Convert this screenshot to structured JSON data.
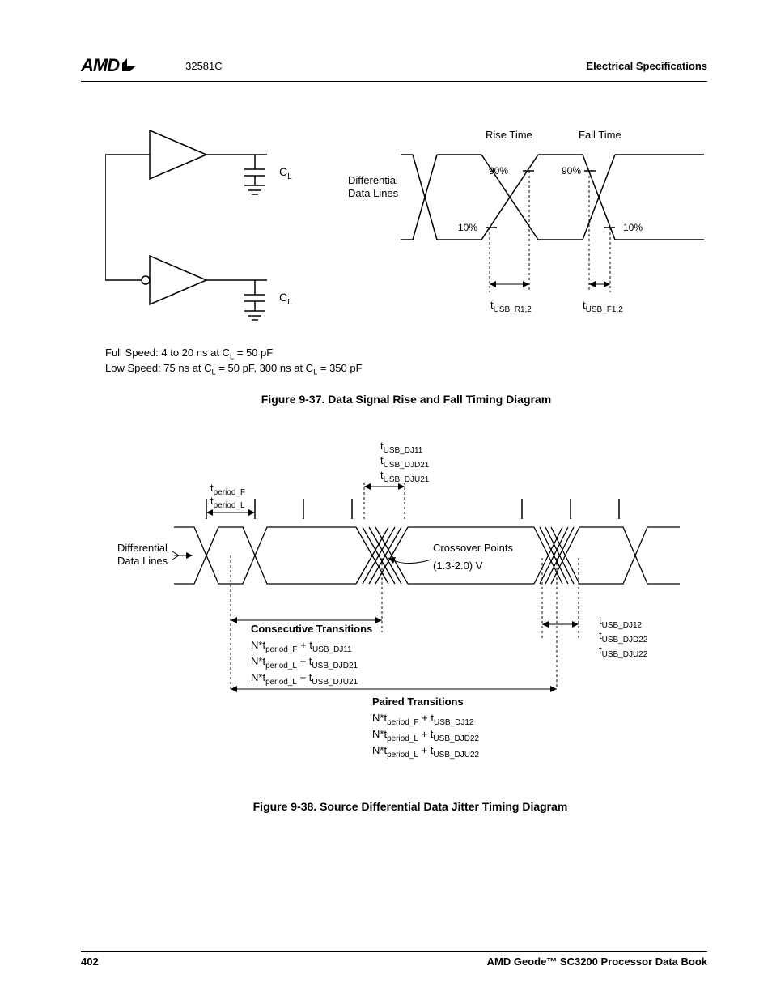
{
  "header": {
    "logo_text": "AMD",
    "doc_number": "32581C",
    "section": "Electrical Specifications"
  },
  "fig37": {
    "cl_label_1": "C",
    "cl_sub_1": "L",
    "cl_label_2": "C",
    "cl_sub_2": "L",
    "dd_lines": "Differential",
    "dd_lines2": "Data Lines",
    "rise_time": "Rise Time",
    "fall_time": "Fall Time",
    "pct90_a": "90%",
    "pct90_b": "90%",
    "pct10_a": "10%",
    "pct10_b": "10%",
    "t_usb_r": "t",
    "t_usb_r_sub": "USB_R1,2",
    "t_usb_f": "t",
    "t_usb_f_sub": "USB_F1,2",
    "note1_pre": "Full Speed: 4 to 20 ns at C",
    "note1_sub": "L",
    "note1_post": " = 50 pF",
    "note2_pre": "Low Speed: 75 ns at C",
    "note2_sub": "L",
    "note2_mid": " = 50 pF, 300 ns at C",
    "note2_sub2": "L",
    "note2_post": " = 350 pF",
    "caption": "Figure 9-37.  Data Signal Rise and Fall Timing Diagram"
  },
  "fig38": {
    "tlist1_a": "t",
    "tlist1_a_sub": "USB_DJ11",
    "tlist1_b": "t",
    "tlist1_b_sub": "USB_DJD21",
    "tlist1_c": "t",
    "tlist1_c_sub": "USB_DJU21",
    "tperiod_f": "t",
    "tperiod_f_sub": "period_F",
    "tperiod_l": "t",
    "tperiod_l_sub": "period_L",
    "dd_lines": "Differential",
    "dd_lines2": "Data Lines",
    "crossover": "Crossover Points",
    "voltage": "(1.3-2.0) V",
    "tlist2_a": "t",
    "tlist2_a_sub": "USB_DJ12",
    "tlist2_b": "t",
    "tlist2_b_sub": "USB_DJD22",
    "tlist2_c": "t",
    "tlist2_c_sub": "USB_DJU22",
    "ct_title": "Consecutive Transitions",
    "ct1_pre": "N*t",
    "ct1_sub": "period_F",
    "ct1_mid": " + t",
    "ct1_sub2": "USB_DJ11",
    "ct2_pre": "N*t",
    "ct2_sub": "period_L",
    "ct2_mid": " + t",
    "ct2_sub2": "USB_DJD21",
    "ct3_pre": "N*t",
    "ct3_sub": "period_L",
    "ct3_mid": " + t",
    "ct3_sub2": "USB_DJU21",
    "pt_title": "Paired Transitions",
    "pt1_pre": "N*t",
    "pt1_sub": "period_F",
    "pt1_mid": " + t",
    "pt1_sub2": "USB_DJ12",
    "pt2_pre": "N*t",
    "pt2_sub": "period_L",
    "pt2_mid": " + t",
    "pt2_sub2": "USB_DJD22",
    "pt3_pre": "N*t",
    "pt3_sub": "period_L",
    "pt3_mid": " + t",
    "pt3_sub2": "USB_DJU22",
    "caption": "Figure 9-38.  Source Differential Data Jitter Timing Diagram"
  },
  "footer": {
    "page": "402",
    "book": "AMD Geode™ SC3200 Processor Data Book"
  }
}
